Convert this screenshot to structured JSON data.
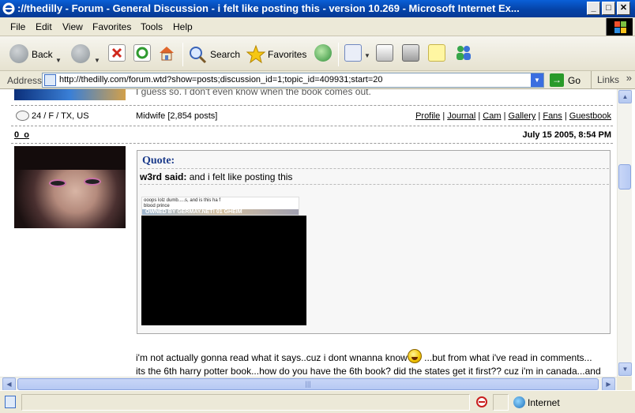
{
  "window": {
    "title": "://thedilly - Forum - General Discussion - i felt like posting this - version 10.269 - Microsoft Internet Ex...",
    "minimize": "_",
    "maximize": "□",
    "close": "✕"
  },
  "menu": [
    "File",
    "Edit",
    "View",
    "Favorites",
    "Tools",
    "Help"
  ],
  "toolbar": {
    "back": "Back",
    "search": "Search",
    "favorites": "Favorites"
  },
  "address": {
    "label": "Address",
    "url": "http://thedilly.com/forum.wtd?show=posts;discussion_id=1;topic_id=409931;start=20",
    "go": "Go",
    "links": "Links",
    "chevron": "»"
  },
  "previous_post": {
    "text_fragment": "I guess so. I don't even know when the book comes out.",
    "location": "24 / F / TX, US",
    "rank": "Midwife [2,854 posts]",
    "links": [
      "Profile",
      "Journal",
      "Cam",
      "Gallery",
      "Fans",
      "Guestbook"
    ],
    "link_sep": "|"
  },
  "post": {
    "username": "0_o",
    "date": "July 15 2005, 8:54 PM",
    "quote": {
      "title": "Quote:",
      "author": "w3rd said:",
      "text": " and i felt like posting this",
      "image_caption_1": "ooops lolz dumb.....s, and is this ha f",
      "image_caption_2": "blood prince",
      "image_banner": "OWNED BY GERMAY.NET! 01 GHEIM"
    },
    "body_line1_a": "i'm not actually gonna read what it says..cuz i dont wnanna know",
    "body_line1_b": " ...but  from what i've read in comments...",
    "body_line2": "its the 6th harry potter book...how do you have the 6th book? did the states get it first?? cuz i'm in canada...and"
  },
  "status": {
    "zone": "Internet"
  },
  "colors": {
    "titlebar": "#0543a8",
    "chrome": "#ece9d8",
    "quote_title": "#1a3a8a"
  }
}
